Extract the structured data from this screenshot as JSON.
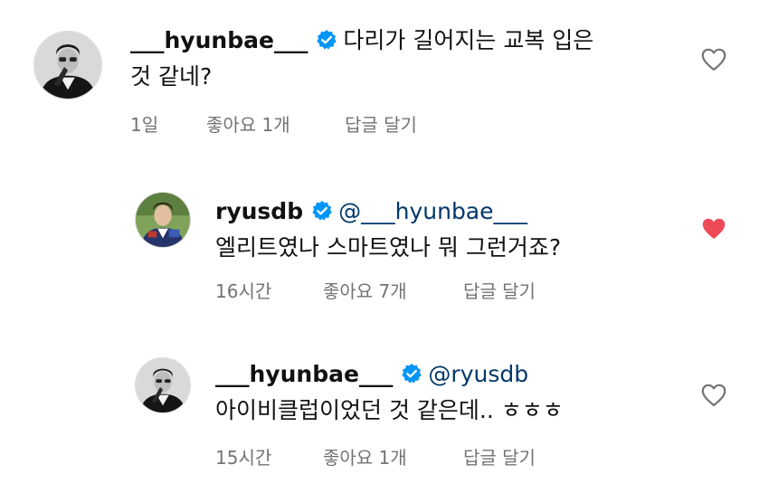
{
  "comments": [
    {
      "username": "___hyunbae___",
      "body_line1": "다리가 길어지는 교복 입은",
      "body_line2": "것 같네?",
      "time": "1일",
      "likes": "좋아요 1개",
      "reply": "답글 달기",
      "avatar_icon": "person-black-suit-avatar",
      "liked": false
    },
    {
      "username": "ryusdb",
      "mention": "@___hyunbae___",
      "body_line1": "엘리트였나 스마트였나 뭐 그런거죠?",
      "time": "16시간",
      "likes": "좋아요 7개",
      "reply": "답글 달기",
      "avatar_icon": "person-school-uniform-avatar",
      "liked": true
    },
    {
      "username": "___hyunbae___",
      "mention": "@ryusdb",
      "body_line1": "아이비클럽이었던 것 같은데.. ㅎㅎㅎ",
      "time": "15시간",
      "likes": "좋아요 1개",
      "reply": "답글 달기",
      "avatar_icon": "person-black-suit-avatar",
      "liked": false
    }
  ],
  "colors": {
    "verified": "#0095f6",
    "liked_heart": "#ed4956",
    "meta_text": "#737373",
    "mention": "#00376b"
  }
}
